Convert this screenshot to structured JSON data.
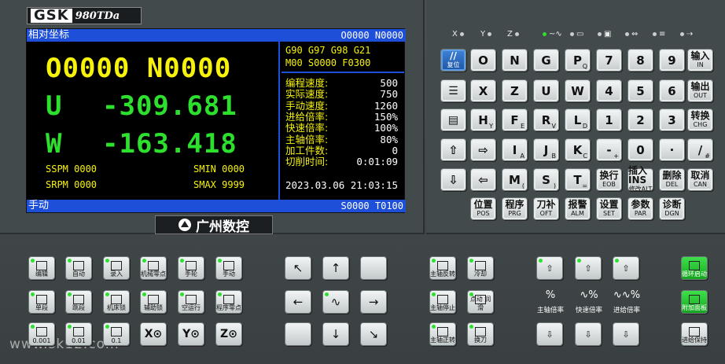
{
  "logo": {
    "brand": "GSK",
    "model": "980TDa"
  },
  "maker_logo": "广州数控",
  "screen": {
    "title": "相对坐标",
    "prog": "O0000 N0000",
    "program_big": "O0000 N0000",
    "u_label": "U",
    "u_value": "-309.681",
    "w_label": "W",
    "w_value": "-163.418",
    "sspm": "SSPM 0000",
    "smin": "SMIN 0000",
    "srpm": "SRPM 0000",
    "smax": "SMAX 9999",
    "modal_line1": "G90 G97 G98 G21",
    "modal_line2": "M00 S0000 F0300",
    "rates": [
      {
        "label": "编程速度:",
        "value": "500"
      },
      {
        "label": "实际速度:",
        "value": "750"
      },
      {
        "label": "手动速度:",
        "value": "1260"
      },
      {
        "label": "进给倍率:",
        "value": "150%"
      },
      {
        "label": "快速倍率:",
        "value": "100%"
      },
      {
        "label": "主轴倍率:",
        "value": "80%"
      },
      {
        "label": "加工件数:",
        "value": "0"
      },
      {
        "label": "切削时间:",
        "value": "0:01:09"
      }
    ],
    "datetime": "2023.03.06 21:03:15",
    "mode": "手动",
    "status": "S0000 T0100"
  },
  "indicators": {
    "x": "X",
    "y": "Y",
    "z": "Z"
  },
  "keys": {
    "reset": "复位",
    "reset_sym": "//",
    "r1": [
      "O",
      "N",
      "G",
      "P",
      "7",
      "8",
      "9"
    ],
    "r1sub": [
      "",
      "",
      "",
      "Q",
      "",
      "",
      ""
    ],
    "in": "输入",
    "in_en": "IN",
    "r2": [
      "X",
      "Z",
      "U",
      "W",
      "4",
      "5",
      "6"
    ],
    "out": "输出",
    "out_en": "OUT",
    "r3": [
      "H",
      "F",
      "R",
      "L",
      "1",
      "2",
      "3"
    ],
    "r3sub": [
      "Y",
      "E",
      "V",
      "D",
      "",
      "",
      ""
    ],
    "chg": "转换",
    "chg_en": "CHG",
    "r4": [
      "I",
      "J",
      "K",
      "-",
      "0",
      "·",
      "/"
    ],
    "r4sub": [
      "A",
      "B",
      "C",
      "+",
      "",
      "",
      "#"
    ],
    "r5": [
      "M",
      "S",
      "T"
    ],
    "r5sub": [
      "(",
      ")",
      "="
    ],
    "eob": "换行",
    "eob_en": "EOB",
    "alt": "插入INS",
    "alt2": "修改ALT",
    "del": "删除",
    "del_en": "DEL",
    "can": "取消",
    "can_en": "CAN",
    "fn": [
      {
        "cn": "位置",
        "en": "POS"
      },
      {
        "cn": "程序",
        "en": "PRG"
      },
      {
        "cn": "刀补",
        "en": "OFT"
      },
      {
        "cn": "报警",
        "en": "ALM"
      },
      {
        "cn": "设置",
        "en": "SET"
      },
      {
        "cn": "参数",
        "en": "PAR"
      },
      {
        "cn": "诊断",
        "en": "DGN"
      }
    ]
  },
  "ops": {
    "modes": [
      "编辑",
      "自动",
      "录入",
      "机械零点",
      "手轮",
      "手动"
    ],
    "modes2": [
      "单段",
      "跳段",
      "机床锁",
      "辅助锁",
      "空运行",
      "程序零点"
    ],
    "modes2top": [
      "",
      "",
      "",
      "MST",
      "",
      ""
    ],
    "steps": [
      "0.001",
      "0.01",
      "0.1"
    ],
    "axes": [
      "X⊙",
      "Y⊙",
      "Z⊙"
    ],
    "spindle": [
      "主轴反转",
      "冷却",
      "主轴停止",
      "点动 润滑",
      "主轴正转",
      "换刀"
    ],
    "over_labels": [
      "主轴倍率",
      "快速倍率",
      "进给倍率"
    ],
    "right": [
      "循环启动",
      "附加面板",
      "进给保持"
    ]
  },
  "watermark": "www.sk12.com",
  "colors": {
    "screen_blue": "#1e4fd8",
    "text_yellow": "#f6f20a",
    "text_green": "#2de02d",
    "accent_key": "#1c56a4"
  }
}
